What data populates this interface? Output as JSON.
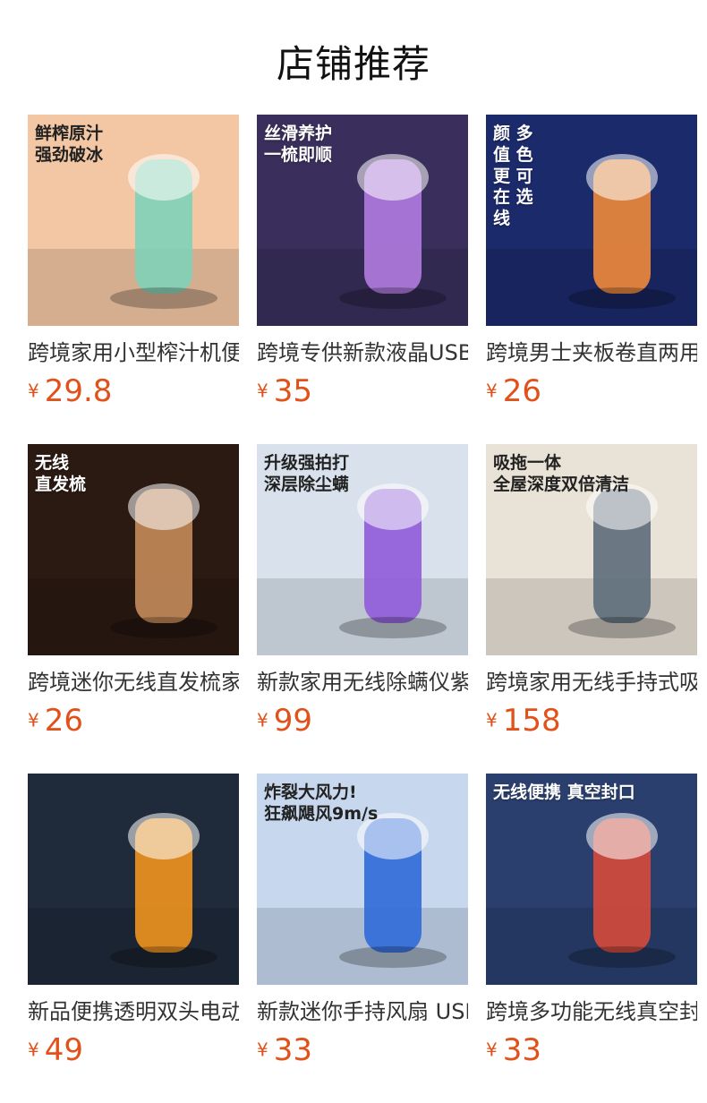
{
  "section": {
    "title": "店铺推荐"
  },
  "currency_symbol": "¥",
  "products": [
    {
      "name": "跨境家用小型榨汁机便携式",
      "price": "29.8",
      "image_caption": "鲜榨原汁\n强劲破冰",
      "bg": "#f3c7a4",
      "accent": "#7fd1b9",
      "caption_dark": true
    },
    {
      "name": "跨境专供新款液晶USB",
      "price": "35",
      "image_caption": "丝滑养护\n一梳即顺",
      "bg": "#3a2f5c",
      "accent": "#b17be0",
      "caption_dark": false
    },
    {
      "name": "跨境男士夹板卷直两用",
      "price": "26",
      "image_caption": "颜 多\n值 色\n更 可\n在 选\n线",
      "bg": "#1b2a6b",
      "accent": "#f08a3a",
      "caption_dark": false
    },
    {
      "name": "跨境迷你无线直发梳家用",
      "price": "26",
      "image_caption": "无线\n直发梳",
      "bg": "#2b1a12",
      "accent": "#c48b5a",
      "caption_dark": false
    },
    {
      "name": "新款家用无线除螨仪紫外线",
      "price": "99",
      "image_caption": "升级强拍打\n深层除尘螨",
      "bg": "#d9e2ec",
      "accent": "#8f5bd9",
      "caption_dark": true
    },
    {
      "name": "跨境家用无线手持式吸尘器",
      "price": "158",
      "image_caption": "吸拖一体\n全屋深度双倍清洁",
      "bg": "#e9e2d6",
      "accent": "#5d6d7a",
      "caption_dark": true
    },
    {
      "name": "新品便携透明双头电动剃须",
      "price": "49",
      "image_caption": "",
      "bg": "#1f2a3a",
      "accent": "#f0931e",
      "caption_dark": false
    },
    {
      "name": "新款迷你手持风扇 USB",
      "price": "33",
      "image_caption": "炸裂大风力!\n狂飙飓风9m/s",
      "bg": "#c7d7ee",
      "accent": "#2f6ad8",
      "caption_dark": true
    },
    {
      "name": "跨境多功能无线真空封口机",
      "price": "33",
      "image_caption": "无线便携 真空封口",
      "bg": "#2a3f6e",
      "accent": "#d64a3a",
      "caption_dark": false
    }
  ]
}
